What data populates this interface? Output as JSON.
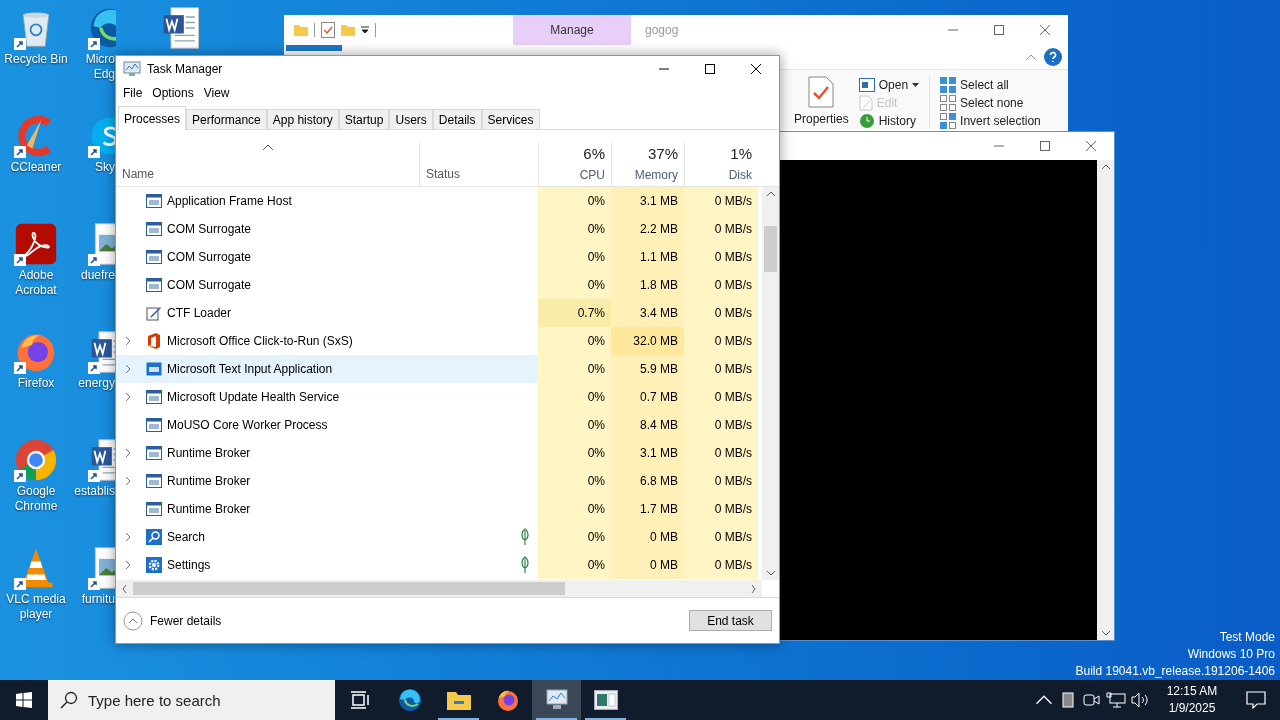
{
  "desktop": {
    "icons_column_1": [
      {
        "kind": "recycle",
        "label_lines": [
          "Recycle Bin"
        ]
      },
      {
        "kind": "ccleaner",
        "label_lines": [
          "CCleaner"
        ]
      },
      {
        "kind": "acrobat",
        "label_lines": [
          "Adobe",
          "Acrobat"
        ]
      },
      {
        "kind": "firefox",
        "label_lines": [
          "Firefox"
        ]
      },
      {
        "kind": "chrome",
        "label_lines": [
          "Google",
          "Chrome"
        ]
      },
      {
        "kind": "vlc",
        "label_lines": [
          "VLC media",
          "player"
        ]
      }
    ],
    "icons_column_2": [
      {
        "kind": "edge",
        "label_lines": [
          "Micro",
          "Edg"
        ]
      },
      {
        "kind": "skype",
        "label_lines": [
          "Sky"
        ]
      },
      {
        "kind": "image",
        "label_lines": [
          "duefre"
        ]
      },
      {
        "kind": "word",
        "label_lines": [
          "energy"
        ]
      },
      {
        "kind": "word",
        "label_lines": [
          "establis"
        ]
      },
      {
        "kind": "image",
        "label_lines": [
          "furnitu"
        ]
      }
    ],
    "icons_column_3": [
      {
        "kind": "word"
      }
    ],
    "edition_lines": [
      "Test Mode",
      "Windows 10 Pro",
      "Build 19041.vb_release.191206-1406"
    ]
  },
  "explorer": {
    "contextual_tab": "Manage",
    "title": "gogog",
    "ribbon": [
      {
        "kind": "big",
        "label": "Properties",
        "disabled": false
      },
      {
        "kind": "open",
        "label": "Open",
        "disabled": false
      },
      {
        "kind": "edit",
        "label": "Edit",
        "disabled": true
      },
      {
        "kind": "history",
        "label": "History",
        "disabled": false
      },
      {
        "kind": "select-all",
        "label": "Select all",
        "disabled": false
      },
      {
        "kind": "select-none",
        "label": "Select none",
        "disabled": false
      },
      {
        "kind": "invert",
        "label": "Invert selection",
        "disabled": false
      }
    ]
  },
  "task_manager": {
    "title": "Task Manager",
    "menu": [
      "File",
      "Options",
      "View"
    ],
    "tabs": [
      {
        "label": "Processes",
        "selected": true
      },
      {
        "label": "Performance",
        "selected": false
      },
      {
        "label": "App history",
        "selected": false
      },
      {
        "label": "Startup",
        "selected": false
      },
      {
        "label": "Users",
        "selected": false
      },
      {
        "label": "Details",
        "selected": false
      },
      {
        "label": "Services",
        "selected": false
      }
    ],
    "columns": [
      {
        "label": "Name"
      },
      {
        "label": "Status"
      },
      {
        "label": "CPU",
        "total": "6%"
      },
      {
        "label": "Memory",
        "total": "37%"
      },
      {
        "label": "Disk",
        "total": "1%"
      }
    ],
    "rows": [
      {
        "name": "Application Frame Host",
        "kind": "window",
        "expandable": false,
        "selected": false,
        "suspended": false,
        "cpu_hot": false,
        "memory_hot": false,
        "cpu": "0%",
        "memory": "3.1 MB",
        "disk": "0 MB/s"
      },
      {
        "name": "COM Surrogate",
        "kind": "window",
        "expandable": false,
        "selected": false,
        "suspended": false,
        "cpu_hot": false,
        "memory_hot": false,
        "cpu": "0%",
        "memory": "2.2 MB",
        "disk": "0 MB/s"
      },
      {
        "name": "COM Surrogate",
        "kind": "window",
        "expandable": false,
        "selected": false,
        "suspended": false,
        "cpu_hot": false,
        "memory_hot": false,
        "cpu": "0%",
        "memory": "1.1 MB",
        "disk": "0 MB/s"
      },
      {
        "name": "COM Surrogate",
        "kind": "window",
        "expandable": false,
        "selected": false,
        "suspended": false,
        "cpu_hot": false,
        "memory_hot": false,
        "cpu": "0%",
        "memory": "1.8 MB",
        "disk": "0 MB/s"
      },
      {
        "name": "CTF Loader",
        "kind": "pen",
        "expandable": false,
        "selected": false,
        "suspended": false,
        "cpu_hot": true,
        "memory_hot": false,
        "cpu": "0.7%",
        "memory": "3.4 MB",
        "disk": "0 MB/s"
      },
      {
        "name": "Microsoft Office Click-to-Run (SxS)",
        "kind": "office",
        "expandable": true,
        "selected": false,
        "suspended": false,
        "cpu_hot": false,
        "memory_hot": true,
        "cpu": "0%",
        "memory": "32.0 MB",
        "disk": "0 MB/s"
      },
      {
        "name": "Microsoft Text Input Application",
        "kind": "keyboard",
        "expandable": true,
        "selected": true,
        "suspended": false,
        "cpu_hot": false,
        "memory_hot": false,
        "cpu": "0%",
        "memory": "5.9 MB",
        "disk": "0 MB/s"
      },
      {
        "name": "Microsoft Update Health Service",
        "kind": "window",
        "expandable": true,
        "selected": false,
        "suspended": false,
        "cpu_hot": false,
        "memory_hot": false,
        "cpu": "0%",
        "memory": "0.7 MB",
        "disk": "0 MB/s"
      },
      {
        "name": "MoUSO Core Worker Process",
        "kind": "window",
        "expandable": false,
        "selected": false,
        "suspended": false,
        "cpu_hot": false,
        "memory_hot": false,
        "cpu": "0%",
        "memory": "8.4 MB",
        "disk": "0 MB/s"
      },
      {
        "name": "Runtime Broker",
        "kind": "window",
        "expandable": true,
        "selected": false,
        "suspended": false,
        "cpu_hot": false,
        "memory_hot": false,
        "cpu": "0%",
        "memory": "3.1 MB",
        "disk": "0 MB/s"
      },
      {
        "name": "Runtime Broker",
        "kind": "window",
        "expandable": true,
        "selected": false,
        "suspended": false,
        "cpu_hot": false,
        "memory_hot": false,
        "cpu": "0%",
        "memory": "6.8 MB",
        "disk": "0 MB/s"
      },
      {
        "name": "Runtime Broker",
        "kind": "window",
        "expandable": false,
        "selected": false,
        "suspended": false,
        "cpu_hot": false,
        "memory_hot": false,
        "cpu": "0%",
        "memory": "1.7 MB",
        "disk": "0 MB/s"
      },
      {
        "name": "Search",
        "kind": "search",
        "expandable": true,
        "selected": false,
        "suspended": true,
        "cpu_hot": false,
        "memory_hot": false,
        "cpu": "0%",
        "memory": "0 MB",
        "disk": "0 MB/s"
      },
      {
        "name": "Settings",
        "kind": "settings",
        "expandable": true,
        "selected": false,
        "suspended": true,
        "cpu_hot": false,
        "memory_hot": false,
        "cpu": "0%",
        "memory": "0 MB",
        "disk": "0 MB/s"
      }
    ],
    "fewer_details": "Fewer details",
    "end_task": "End task"
  },
  "taskbar": {
    "search_placeholder": "Type here to search",
    "apps": [
      {
        "kind": "task-view",
        "running": false,
        "active": false
      },
      {
        "kind": "edge",
        "running": false,
        "active": false
      },
      {
        "kind": "explorer",
        "running": true,
        "active": false
      },
      {
        "kind": "firefox",
        "running": false,
        "active": false
      },
      {
        "kind": "taskmgr",
        "running": true,
        "active": true
      },
      {
        "kind": "console",
        "running": true,
        "active": false
      }
    ],
    "time": "12:15 AM",
    "date": "1/9/2025"
  }
}
